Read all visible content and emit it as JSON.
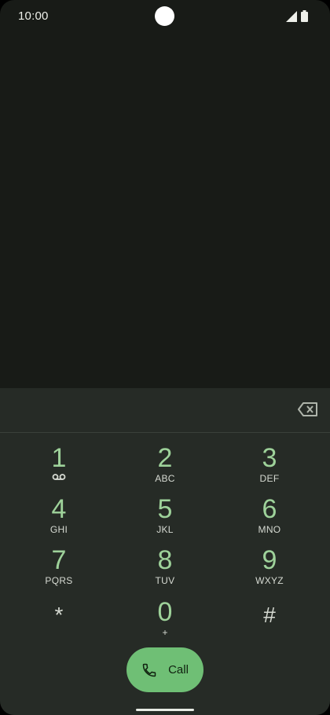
{
  "status_bar": {
    "time": "10:00"
  },
  "dialpad": {
    "keys": [
      {
        "digit": "1",
        "letters": "",
        "extra": "voicemail-icon"
      },
      {
        "digit": "2",
        "letters": "ABC"
      },
      {
        "digit": "3",
        "letters": "DEF"
      },
      {
        "digit": "4",
        "letters": "GHI"
      },
      {
        "digit": "5",
        "letters": "JKL"
      },
      {
        "digit": "6",
        "letters": "MNO"
      },
      {
        "digit": "7",
        "letters": "PQRS"
      },
      {
        "digit": "8",
        "letters": "TUV"
      },
      {
        "digit": "9",
        "letters": "WXYZ"
      },
      {
        "digit": "*",
        "letters": ""
      },
      {
        "digit": "0",
        "letters": "+"
      },
      {
        "digit": "#",
        "letters": ""
      }
    ]
  },
  "call_button": {
    "label": "Call",
    "icon": "phone-icon"
  },
  "backspace": {
    "icon": "backspace-icon"
  },
  "colors": {
    "background": "#181b17",
    "dialpad_panel": "#262b26",
    "digit": "#9ed29a",
    "call_button": "#6fbf75"
  }
}
